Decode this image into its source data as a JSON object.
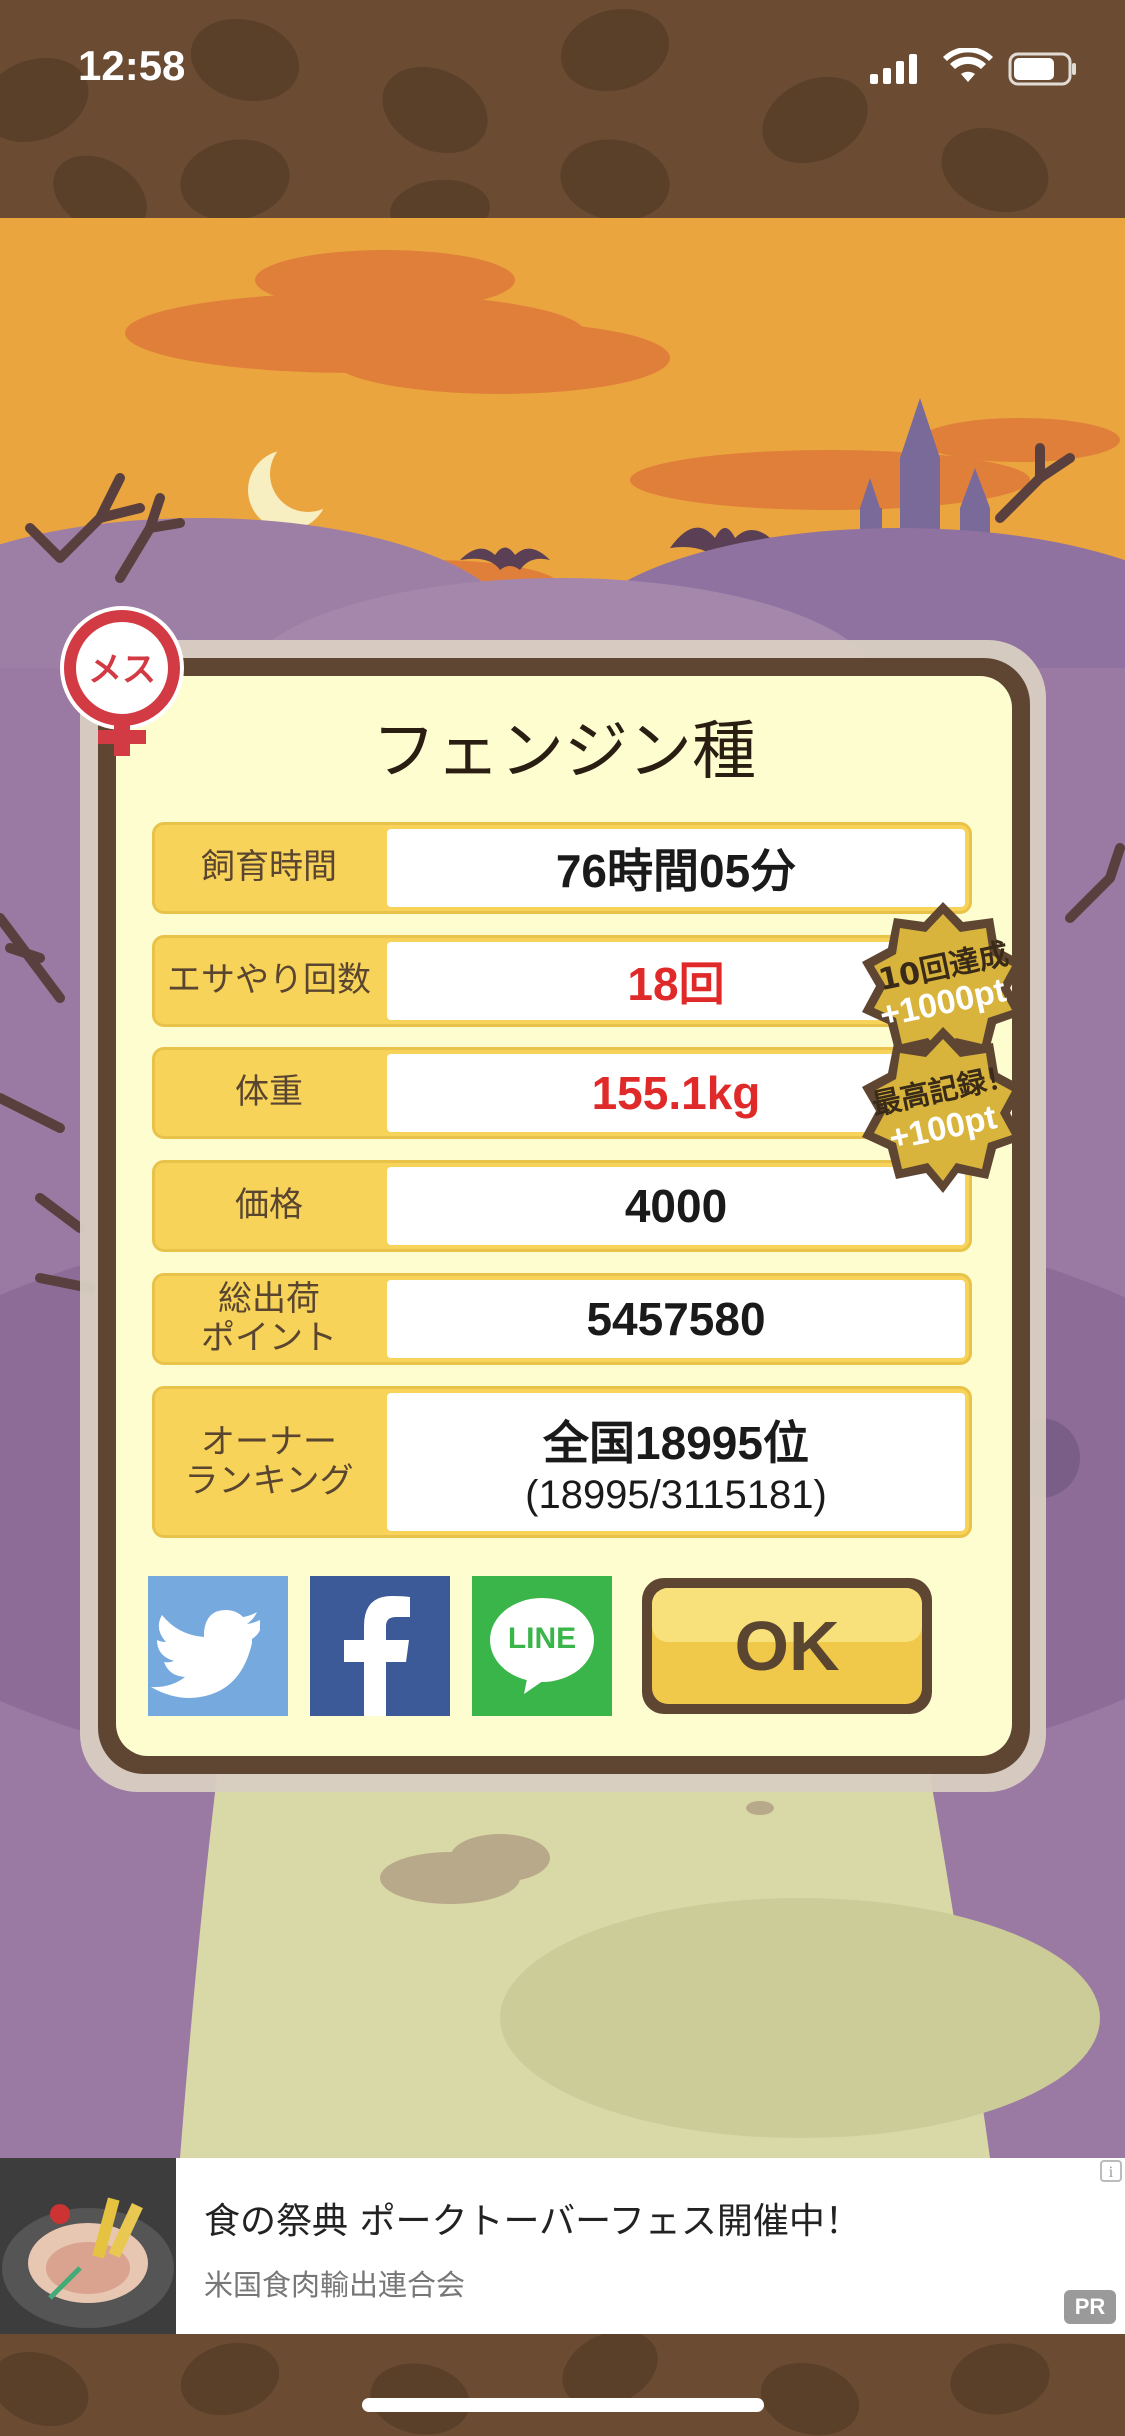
{
  "status_bar": {
    "time": "12:58"
  },
  "badge_female": "メス",
  "dialog": {
    "title": "フェンジン種",
    "rows": [
      {
        "label": "飼育時間",
        "value": "76時間05分",
        "highlight": false
      },
      {
        "label": "エサやり回数",
        "value": "18回",
        "highlight": true
      },
      {
        "label": "体重",
        "value": "155.1kg",
        "highlight": true
      },
      {
        "label": "価格",
        "value": "4000",
        "highlight": false
      },
      {
        "label": "総出荷ポイント",
        "label_line1": "総出荷",
        "label_line2": "ポイント",
        "value": "5457580",
        "highlight": false
      },
      {
        "label": "オーナーランキング",
        "label_line1": "オーナー",
        "label_line2": "ランキング",
        "value": "全国18995位",
        "value_sub": "(18995/3115181)",
        "highlight": false
      }
    ],
    "achievements": [
      {
        "line1": "10回達成",
        "line2": "+1000pt"
      },
      {
        "line1": "最高記録！",
        "line2": "+100pt"
      }
    ],
    "share_buttons": {
      "line_label": "LINE"
    },
    "ok_label": "OK"
  },
  "ad": {
    "title": "食の祭典 ポークトーバーフェス開催中！",
    "sponsor": "米国食肉輸出連合会",
    "pr_label": "PR",
    "info_label": "i"
  },
  "colors": {
    "sky": "#e9a23e",
    "hill_purple": "#9b7aa0",
    "frame_brown": "#5e4632",
    "panel_cream": "#fefdd0",
    "label_yellow": "#f7d459",
    "highlight_red": "#e02a2a",
    "twitter": "#76a9dd",
    "facebook": "#3d5a98",
    "line": "#3ab54a"
  }
}
